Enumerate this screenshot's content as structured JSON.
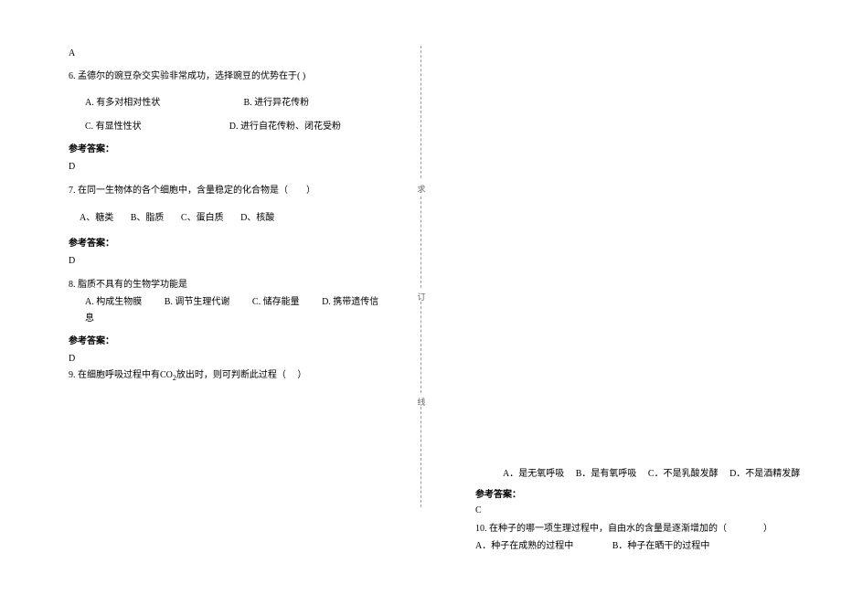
{
  "left": {
    "topA": "A",
    "q6": {
      "text": "6. 孟德尔的豌豆杂交实验非常成功，选择豌豆的优势在于(    )",
      "optA": "A. 有多对相对性状",
      "optB": "B. 进行异花传粉",
      "optC": "C. 有显性性状",
      "optD": "D. 进行自花传粉、闭花受粉",
      "ansLabel": "参考答案：",
      "ansVal": "D"
    },
    "q7": {
      "text": "7. 在同一生物体的各个细胞中，含量稳定的化合物是（　　）",
      "optA": "A、糖类",
      "optB": "B、脂质",
      "optC": "C、蛋白质",
      "optD": "D、核酸",
      "ansLabel": "参考答案：",
      "ansVal": "D"
    },
    "q8": {
      "text": "8. 脂质不具有的生物学功能是",
      "optA": "A. 构成生物膜",
      "optB": "B. 调节生理代谢",
      "optC": "C. 储存能量",
      "optD": "D. 携带遗传信息",
      "ansLabel": "参考答案：",
      "ansVal": "D"
    },
    "q9": {
      "text_pre": "9. 在细胞呼吸过程中有CO",
      "text_sub": "2",
      "text_post": "放出时，则可判断此过程（　 ）"
    }
  },
  "divider": {
    "t1": "求",
    "t2": "订",
    "t3": "线"
  },
  "right": {
    "q9opts": {
      "a": "A．是无氧呼吸",
      "b": "B．是有氧呼吸",
      "c": "C．不是乳酸发酵",
      "d": "D．不是酒精发酵"
    },
    "ansLabel": "参考答案：",
    "ansVal": "C",
    "q10": {
      "text": "10. 在种子的哪一项生理过程中，自由水的含量是逐渐增加的（　　　　）",
      "optA": "A．种子在成熟的过程中",
      "optB": "B．种子在晒干的过程中"
    }
  }
}
